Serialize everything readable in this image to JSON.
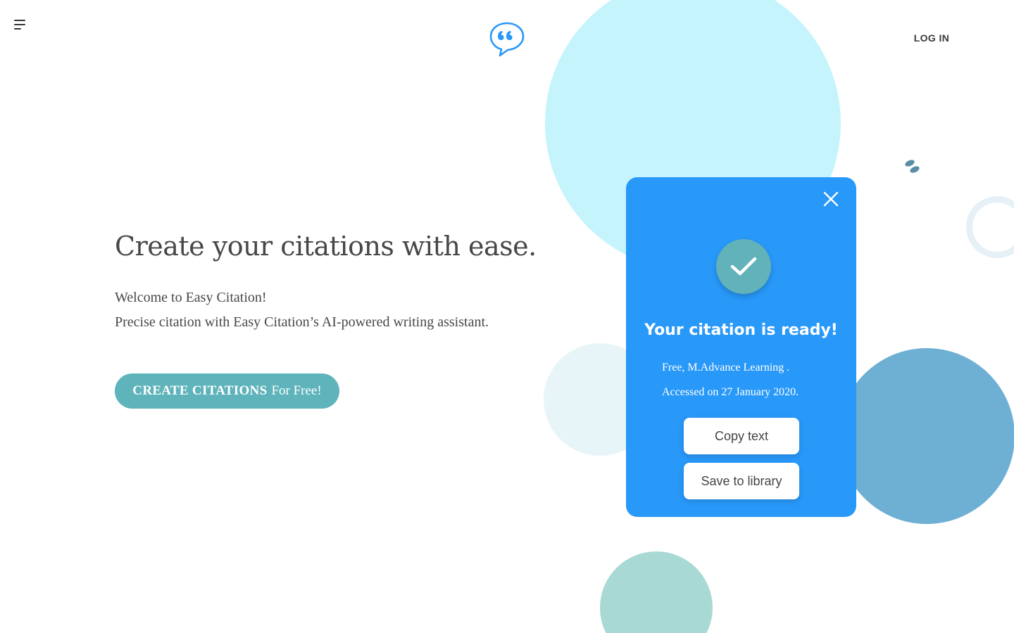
{
  "header": {
    "menu_icon": "hamburger-menu-icon",
    "logo_icon": "quote-speech-bubble-icon",
    "login_label": "LOG IN"
  },
  "hero": {
    "title": "Create your citations with ease.",
    "welcome": "Welcome to Easy Citation!",
    "tagline": "Precise citation with Easy Citation’s AI-powered writing assistant.",
    "cta_strong": "CREATE CITATIONS",
    "cta_rest": "For Free!"
  },
  "card": {
    "close_icon": "close-icon",
    "check_icon": "checkmark-icon",
    "title": "Your citation is ready!",
    "citation_line1": "Free, M.Advance Learning .",
    "citation_line2": "Accessed on 27 January 2020.",
    "copy_label": "Copy text",
    "save_label": "Save to library"
  },
  "colors": {
    "card_bg": "#2898f9",
    "cta_bg": "#5fb3bb",
    "check_badge": "#62b2ba",
    "circle_cyan": "#c5f4fd",
    "circle_blue": "#6eafd4",
    "circle_teal": "#a8d9d4",
    "logo_blue": "#2898f9"
  }
}
